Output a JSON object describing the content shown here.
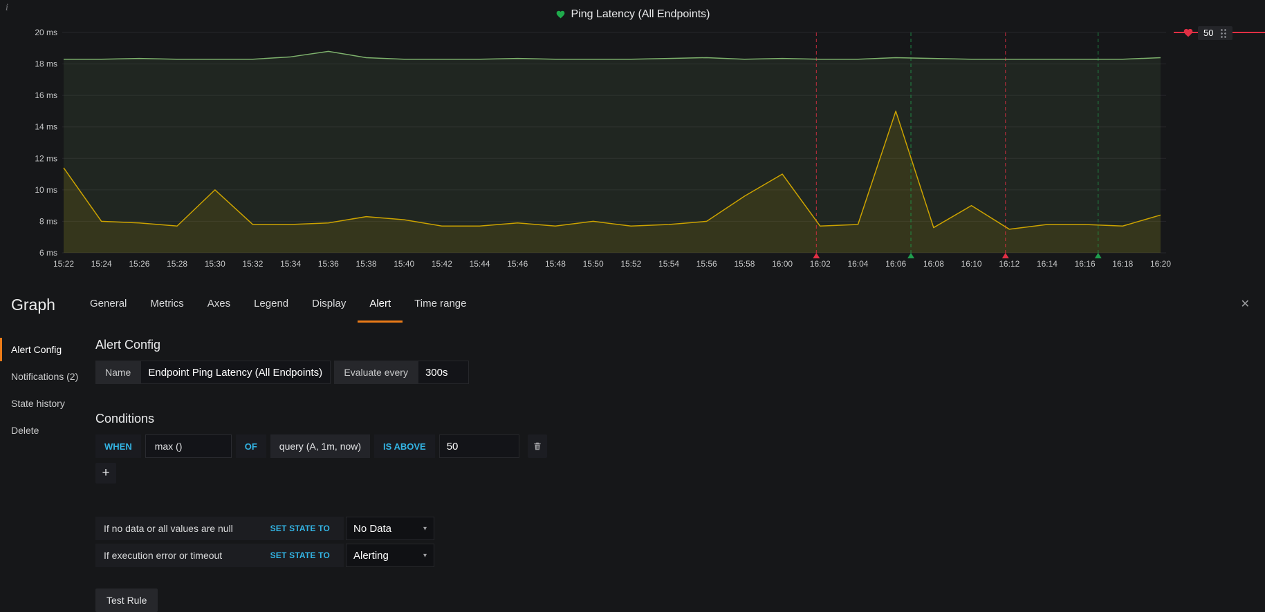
{
  "panel": {
    "title": "Ping Latency (All Endpoints)",
    "info_icon": "i"
  },
  "chart_data": {
    "type": "line",
    "title": "Ping Latency (All Endpoints)",
    "y_unit": "ms",
    "ylim": [
      6,
      20
    ],
    "yticks": [
      20,
      18,
      16,
      14,
      12,
      10,
      8,
      6
    ],
    "grid": true,
    "legend": false,
    "x": [
      "15:22",
      "15:24",
      "15:26",
      "15:28",
      "15:30",
      "15:32",
      "15:34",
      "15:36",
      "15:38",
      "15:40",
      "15:42",
      "15:44",
      "15:46",
      "15:48",
      "15:50",
      "15:52",
      "15:54",
      "15:56",
      "15:58",
      "16:00",
      "16:02",
      "16:04",
      "16:06",
      "16:08",
      "16:10",
      "16:12",
      "16:14",
      "16:16",
      "16:18",
      "16:20"
    ],
    "series": [
      {
        "color": "#7eb26d",
        "fill": "rgba(126,178,109,0.10)",
        "values": [
          18.3,
          18.3,
          18.35,
          18.3,
          18.3,
          18.3,
          18.45,
          18.8,
          18.4,
          18.3,
          18.3,
          18.3,
          18.35,
          18.3,
          18.3,
          18.3,
          18.35,
          18.4,
          18.3,
          18.35,
          18.3,
          18.3,
          18.4,
          18.35,
          18.3,
          18.3,
          18.3,
          18.3,
          18.3,
          18.4
        ]
      },
      {
        "color": "#cca300",
        "fill": "rgba(204,163,0,0.13)",
        "values": [
          11.4,
          8.0,
          7.9,
          7.7,
          10.0,
          7.8,
          7.8,
          7.9,
          8.3,
          8.1,
          7.7,
          7.7,
          7.9,
          7.7,
          8.0,
          7.7,
          7.8,
          8.0,
          9.6,
          11.0,
          7.7,
          7.8,
          15.0,
          7.6,
          9.0,
          7.5,
          7.8,
          7.8,
          7.7,
          8.4
        ]
      }
    ],
    "annotations": [
      {
        "x_index": 19.9,
        "color": "#e02f44",
        "kind": "alerting"
      },
      {
        "x_index": 22.4,
        "color": "#1f9d4d",
        "kind": "ok"
      },
      {
        "x_index": 24.9,
        "color": "#e02f44",
        "kind": "alerting"
      },
      {
        "x_index": 27.35,
        "color": "#1f9d4d",
        "kind": "ok"
      }
    ],
    "threshold": {
      "value": "50",
      "color": "#e02f44"
    }
  },
  "icons": {
    "close": "✕",
    "plus": "+",
    "caret": "▾"
  },
  "editor": {
    "panel_type": "Graph",
    "tabs": [
      "General",
      "Metrics",
      "Axes",
      "Legend",
      "Display",
      "Alert",
      "Time range"
    ],
    "active_tab": "Alert",
    "sidebar": [
      "Alert Config",
      "Notifications (2)",
      "State history",
      "Delete"
    ],
    "alert_config": {
      "heading": "Alert Config",
      "name_label": "Name",
      "name_value": "Endpoint Ping Latency (All Endpoints) a...",
      "evaluate_label": "Evaluate every",
      "evaluate_value": "300s"
    },
    "conditions": {
      "heading": "Conditions",
      "when": "WHEN",
      "aggregation": "max ()",
      "of": "OF",
      "query": "query (A, 1m, now)",
      "operator": "IS ABOVE",
      "threshold": "50"
    },
    "fallbacks": [
      {
        "label": "If no data or all values are null",
        "action": "SET STATE TO",
        "value": "No Data"
      },
      {
        "label": "If execution error or timeout",
        "action": "SET STATE TO",
        "value": "Alerting"
      }
    ],
    "test_rule": "Test Rule"
  }
}
